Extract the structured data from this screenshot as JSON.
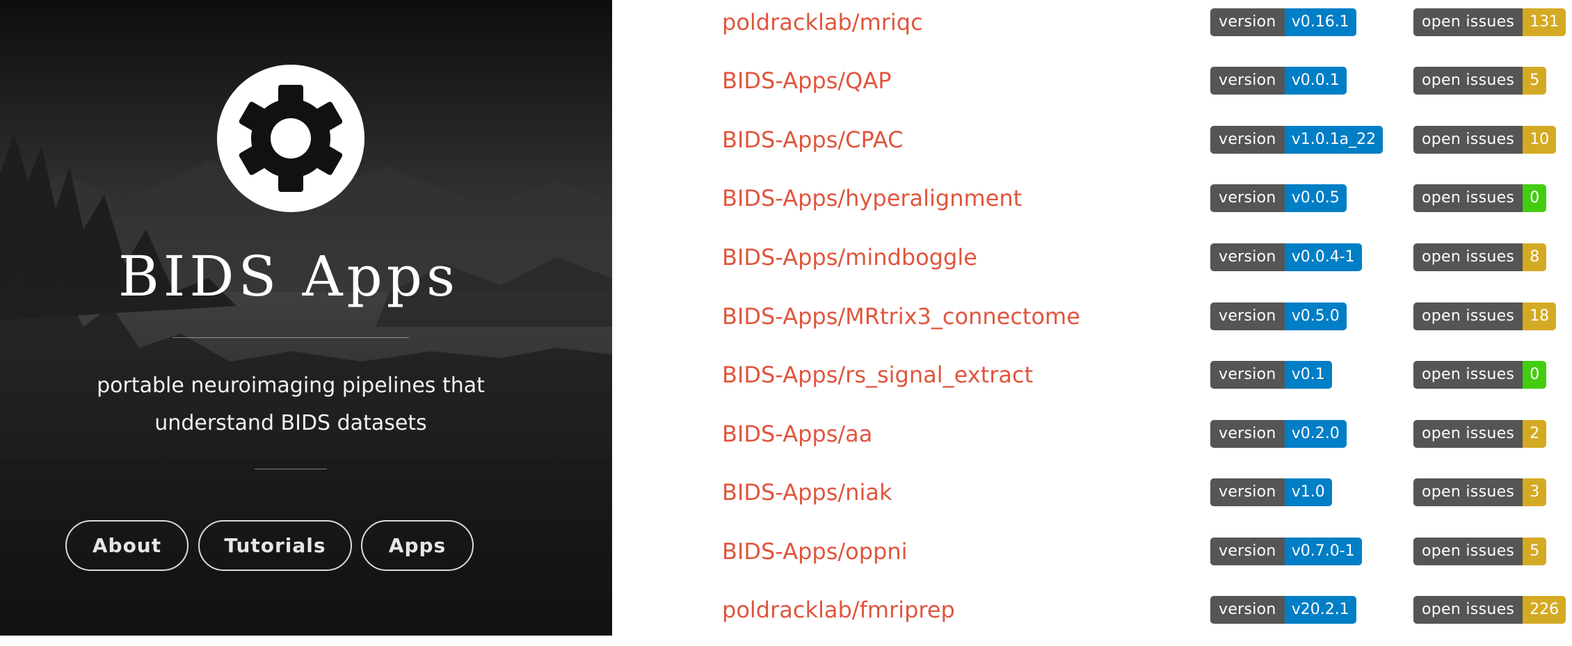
{
  "sidebar": {
    "title": "BIDS Apps",
    "tagline_line1": "portable neuroimaging pipelines that",
    "tagline_line2": "understand BIDS datasets",
    "logo_icon": "gear-icon",
    "nav": [
      {
        "label": "About"
      },
      {
        "label": "Tutorials"
      },
      {
        "label": "Apps"
      }
    ]
  },
  "badge_labels": {
    "version": "version",
    "issues": "open issues"
  },
  "colors": {
    "link": "#e0553d",
    "badge_label": "#555555",
    "version": "#007ec6",
    "issues_some": "#d4aa24",
    "issues_none": "#4c1"
  },
  "apps": [
    {
      "name": "poldracklab/mriqc",
      "version": "v0.16.1",
      "issues": "131",
      "issues_color": "#d4aa24"
    },
    {
      "name": "BIDS-Apps/QAP",
      "version": "v0.0.1",
      "issues": "5",
      "issues_color": "#d4aa24"
    },
    {
      "name": "BIDS-Apps/CPAC",
      "version": "v1.0.1a_22",
      "issues": "10",
      "issues_color": "#d4aa24"
    },
    {
      "name": "BIDS-Apps/hyperalignment",
      "version": "v0.0.5",
      "issues": "0",
      "issues_color": "#4c1"
    },
    {
      "name": "BIDS-Apps/mindboggle",
      "version": "v0.0.4-1",
      "issues": "8",
      "issues_color": "#d4aa24"
    },
    {
      "name": "BIDS-Apps/MRtrix3_connectome",
      "version": "v0.5.0",
      "issues": "18",
      "issues_color": "#d4aa24"
    },
    {
      "name": "BIDS-Apps/rs_signal_extract",
      "version": "v0.1",
      "issues": "0",
      "issues_color": "#4c1"
    },
    {
      "name": "BIDS-Apps/aa",
      "version": "v0.2.0",
      "issues": "2",
      "issues_color": "#d4aa24"
    },
    {
      "name": "BIDS-Apps/niak",
      "version": "v1.0",
      "issues": "3",
      "issues_color": "#d4aa24"
    },
    {
      "name": "BIDS-Apps/oppni",
      "version": "v0.7.0-1",
      "issues": "5",
      "issues_color": "#d4aa24"
    },
    {
      "name": "poldracklab/fmriprep",
      "version": "v20.2.1",
      "issues": "226",
      "issues_color": "#d4aa24"
    }
  ]
}
